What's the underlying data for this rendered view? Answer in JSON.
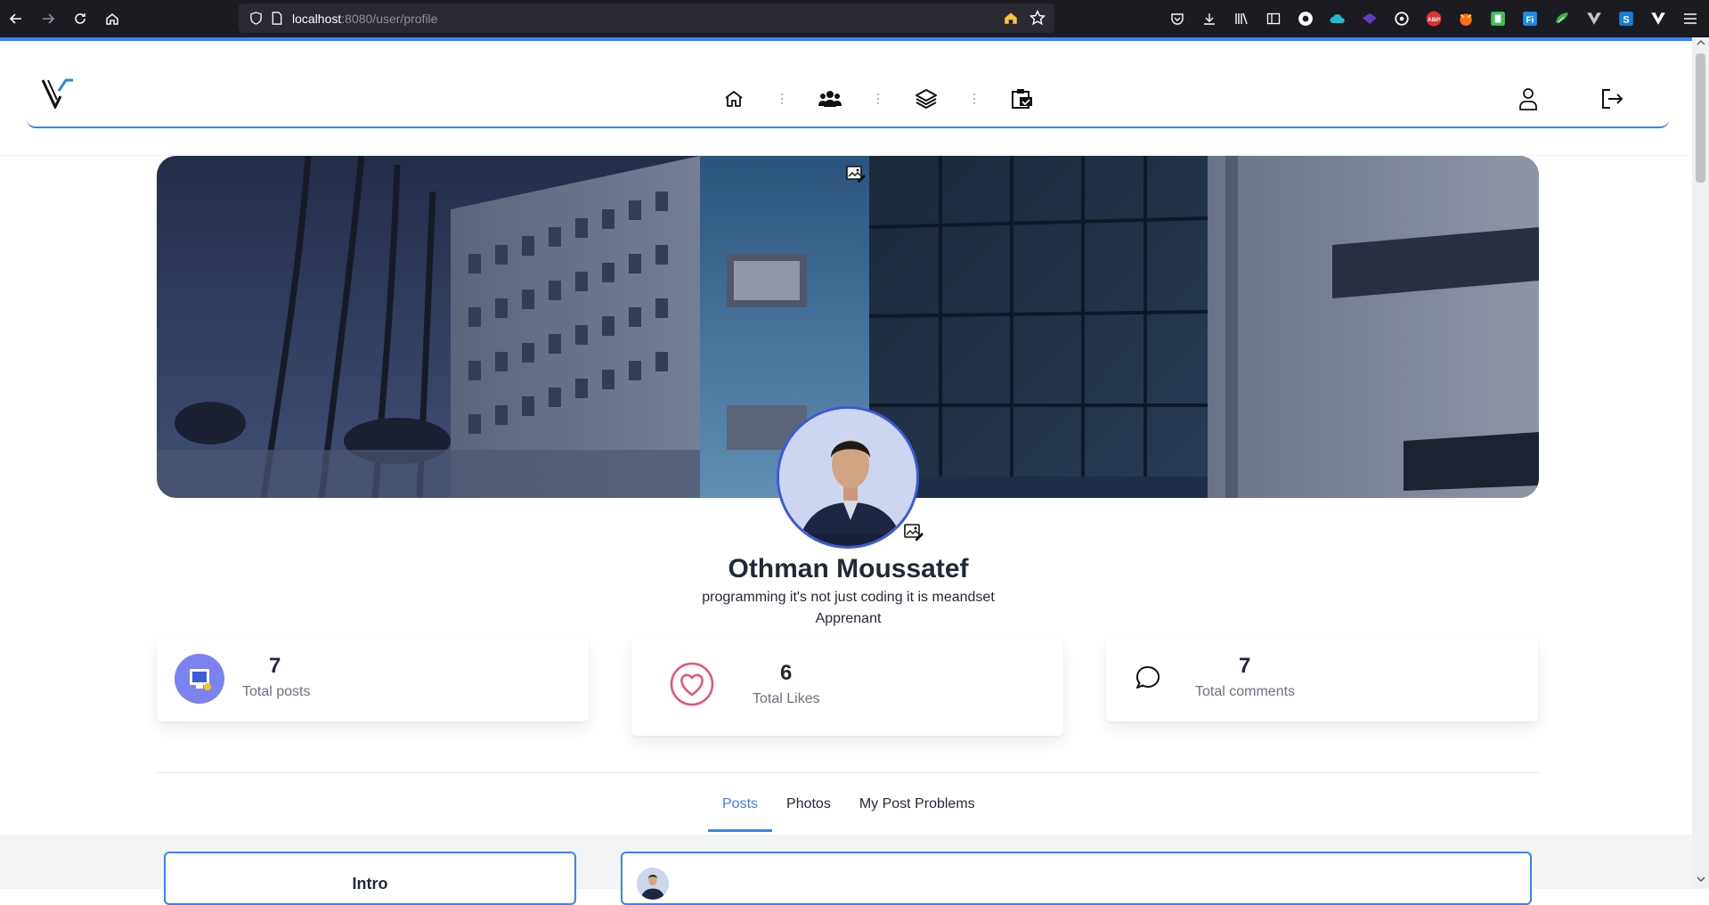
{
  "browser": {
    "url_host": "localhost",
    "url_path": ":8080/user/profile"
  },
  "profile": {
    "name": "Othman Moussatef",
    "bio": "programming it's not just coding it is meandset",
    "role": "Apprenant"
  },
  "stats": [
    {
      "value": "7",
      "label": "Total posts"
    },
    {
      "value": "6",
      "label": "Total Likes"
    },
    {
      "value": "7",
      "label": "Total comments"
    }
  ],
  "tabs": [
    {
      "label": "Posts",
      "active": true
    },
    {
      "label": "Photos",
      "active": false
    },
    {
      "label": "My Post Problems",
      "active": false
    }
  ],
  "intro": {
    "title": "Intro"
  },
  "colors": {
    "accent": "#3b82f6",
    "heart": "#f0506e",
    "posts_icon_bg": "#7c83f0"
  }
}
